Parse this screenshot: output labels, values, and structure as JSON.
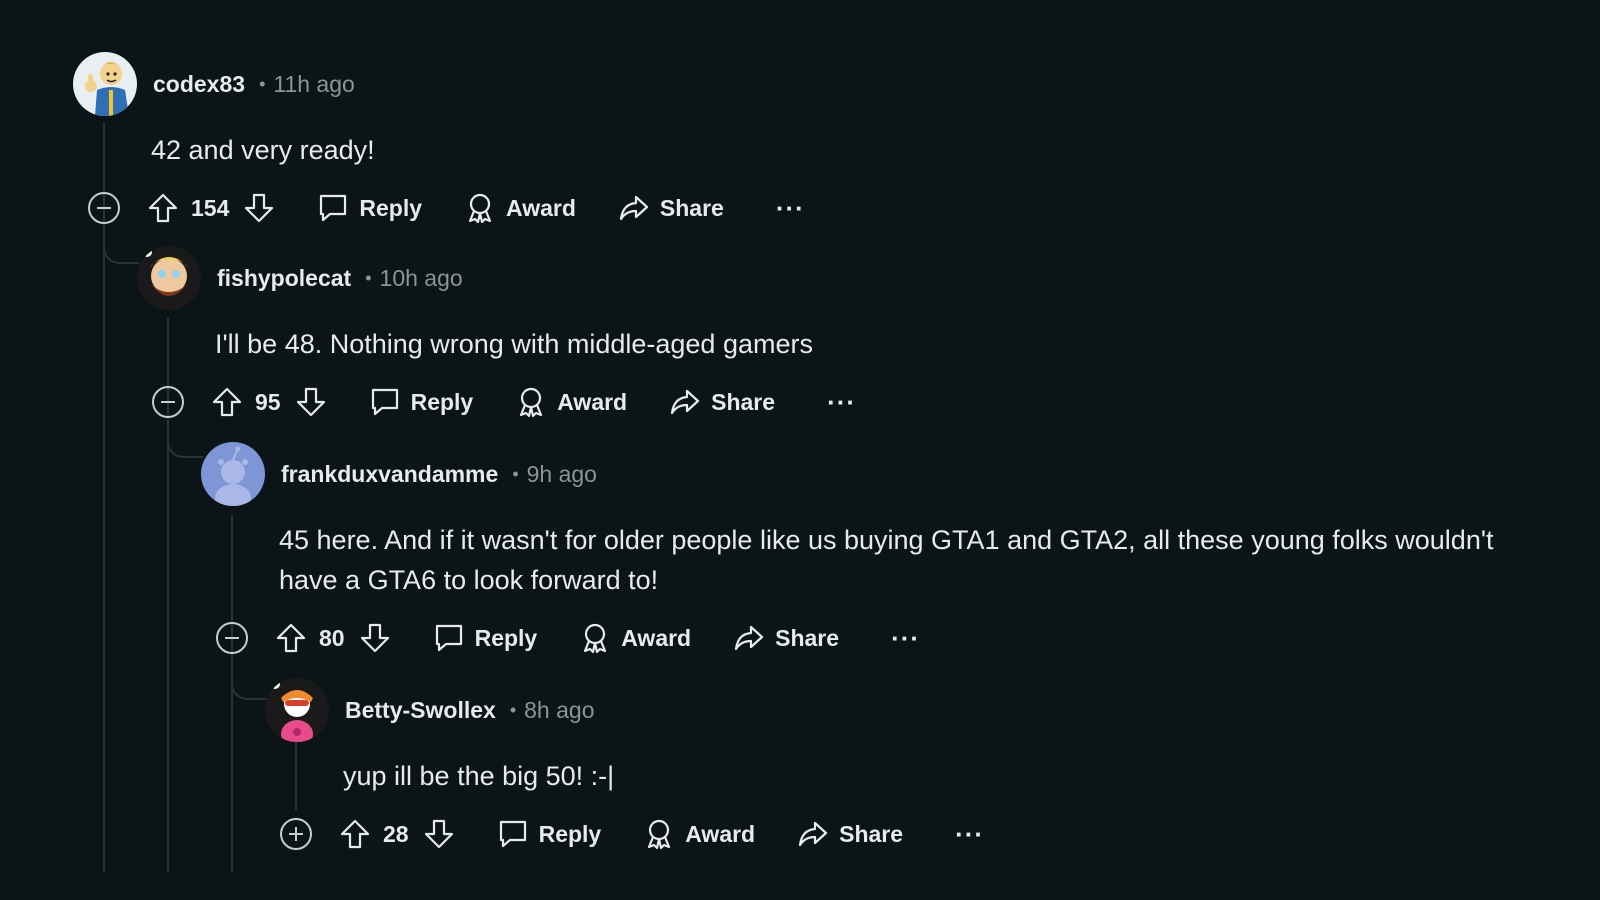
{
  "comments": [
    {
      "username": "codex83",
      "separator": "•",
      "time": "11h ago",
      "text": "42 and very ready!",
      "votes": "154",
      "reply_label": "Reply",
      "award_label": "Award",
      "share_label": "Share",
      "more_label": "···",
      "collapsed": false
    },
    {
      "username": "fishypolecat",
      "separator": "•",
      "time": "10h ago",
      "text": "I'll be 48. Nothing wrong with middle-aged gamers",
      "votes": "95",
      "reply_label": "Reply",
      "award_label": "Award",
      "share_label": "Share",
      "more_label": "···",
      "collapsed": false
    },
    {
      "username": "frankduxvandamme",
      "separator": "•",
      "time": "9h ago",
      "text": "45 here. And if it wasn't for older people like us buying GTA1 and GTA2, all these young folks wouldn't have a GTA6 to look forward to!",
      "votes": "80",
      "reply_label": "Reply",
      "award_label": "Award",
      "share_label": "Share",
      "more_label": "···",
      "collapsed": false
    },
    {
      "username": "Betty-Swollex",
      "separator": "•",
      "time": "8h ago",
      "text": "yup ill be the big 50! :-|",
      "votes": "28",
      "reply_label": "Reply",
      "award_label": "Award",
      "share_label": "Share",
      "more_label": "···",
      "collapsed": true
    }
  ],
  "colors": {
    "background": "#0b1416",
    "text": "#e8eaed",
    "meta": "#8a9499",
    "thread": "#2a3236"
  }
}
